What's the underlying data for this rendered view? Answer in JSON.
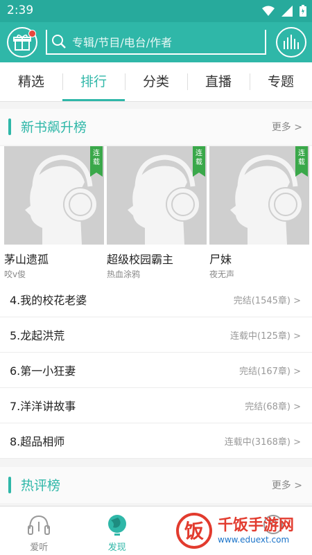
{
  "status_bar": {
    "time": "2:39"
  },
  "header": {
    "search_placeholder": "专辑/节目/电台/作者"
  },
  "tabs": [
    {
      "label": "精选"
    },
    {
      "label": "排行"
    },
    {
      "label": "分类"
    },
    {
      "label": "直播"
    },
    {
      "label": "专题"
    }
  ],
  "section_new": {
    "title": "新书飙升榜",
    "more": "更多 >"
  },
  "cards": [
    {
      "badge": "连载",
      "title": "茅山遗孤",
      "author": "咬v俊"
    },
    {
      "badge": "连载",
      "title": "超级校园霸主",
      "author": "热血涂鸦"
    },
    {
      "badge": "连载",
      "title": "尸妹",
      "author": "夜无声"
    }
  ],
  "list": [
    {
      "title": "4.我的校花老婆",
      "status": "完结(1545章) >"
    },
    {
      "title": "5.龙起洪荒",
      "status": "连载中(125章) >"
    },
    {
      "title": "6.第一小狂妻",
      "status": "完结(167章) >"
    },
    {
      "title": "7.洋洋讲故事",
      "status": "完结(68章) >"
    },
    {
      "title": "8.超品相师",
      "status": "连载中(3168章) >"
    }
  ],
  "section_hot": {
    "title": "热评榜",
    "more": "更多 >"
  },
  "bottom_nav": [
    {
      "label": "爱听",
      "icon": "headphones-icon"
    },
    {
      "label": "发现",
      "icon": "globe-icon"
    },
    {
      "label": "",
      "icon": "tab-icon"
    },
    {
      "label": "",
      "icon": "profile-icon"
    }
  ],
  "watermark": {
    "main": "千饭手游网",
    "sub": "www.eduext.com",
    "logo": "饭"
  },
  "colors": {
    "accent": "#2fb7a8",
    "badge": "#3aa84a",
    "watermark_red": "#e23b2e"
  }
}
